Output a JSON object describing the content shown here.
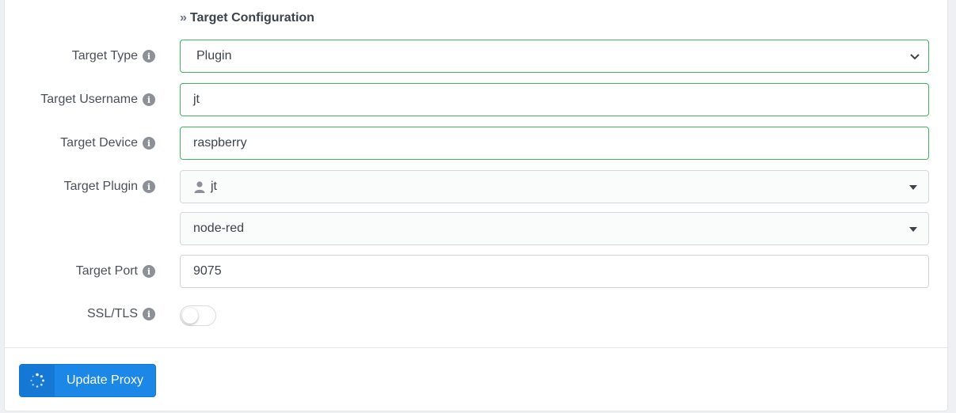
{
  "section": {
    "title": "Target Configuration"
  },
  "fields": {
    "target_type": {
      "label": "Target Type",
      "value": "Plugin"
    },
    "target_username": {
      "label": "Target Username",
      "value": "jt"
    },
    "target_device": {
      "label": "Target Device",
      "value": "raspberry"
    },
    "target_plugin": {
      "label": "Target Plugin",
      "user_value": "jt",
      "plugin_value": "node-red"
    },
    "target_port": {
      "label": "Target Port",
      "value": "9075"
    },
    "ssl_tls": {
      "label": "SSL/TLS",
      "enabled": false
    }
  },
  "info_icon_glyph": "i",
  "actions": {
    "update_label": "Update Proxy"
  },
  "colors": {
    "valid_border": "#3fb55a",
    "primary": "#1b87e6"
  }
}
